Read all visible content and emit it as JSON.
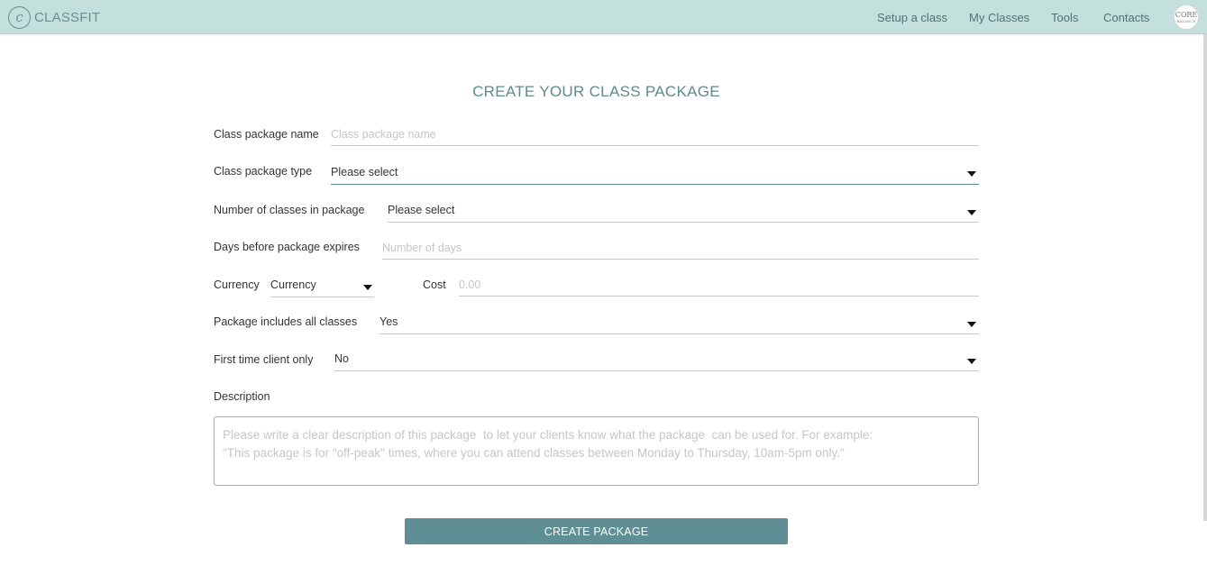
{
  "header": {
    "brand": "CLASSFIT",
    "brand_mark": "c",
    "nav": [
      "Setup a class",
      "My Classes",
      "Tools",
      "Contacts"
    ],
    "avatar": {
      "line1": "CORE",
      "line2": "BALANCE"
    }
  },
  "form": {
    "title": "CREATE YOUR CLASS PACKAGE",
    "name": {
      "label": "Class package name",
      "placeholder": "Class package name"
    },
    "type": {
      "label": "Class package type",
      "value": "Please select"
    },
    "num_classes": {
      "label": "Number of classes in package",
      "value": "Please select"
    },
    "expiry": {
      "label": "Days before package expires",
      "placeholder": "Number of days"
    },
    "currency": {
      "label": "Currency",
      "value": "Currency"
    },
    "cost": {
      "label": "Cost",
      "placeholder": "0.00"
    },
    "all_classes": {
      "label": "Package includes all classes",
      "value": "Yes"
    },
    "first_time": {
      "label": "First time client only",
      "value": "No"
    },
    "description": {
      "label": "Description",
      "placeholder": "Please write a clear description of this package  to let your clients know what the package  can be used for. For example:\n\"This package is for \"off-peak\" times, where you can attend classes between Monday to Thursday, 10am-5pm only.\""
    },
    "submit_label": "CREATE PACKAGE"
  },
  "colors": {
    "header_bg": "#c4e0dc",
    "accent": "#5f8f94",
    "title": "#5f8a8c"
  }
}
